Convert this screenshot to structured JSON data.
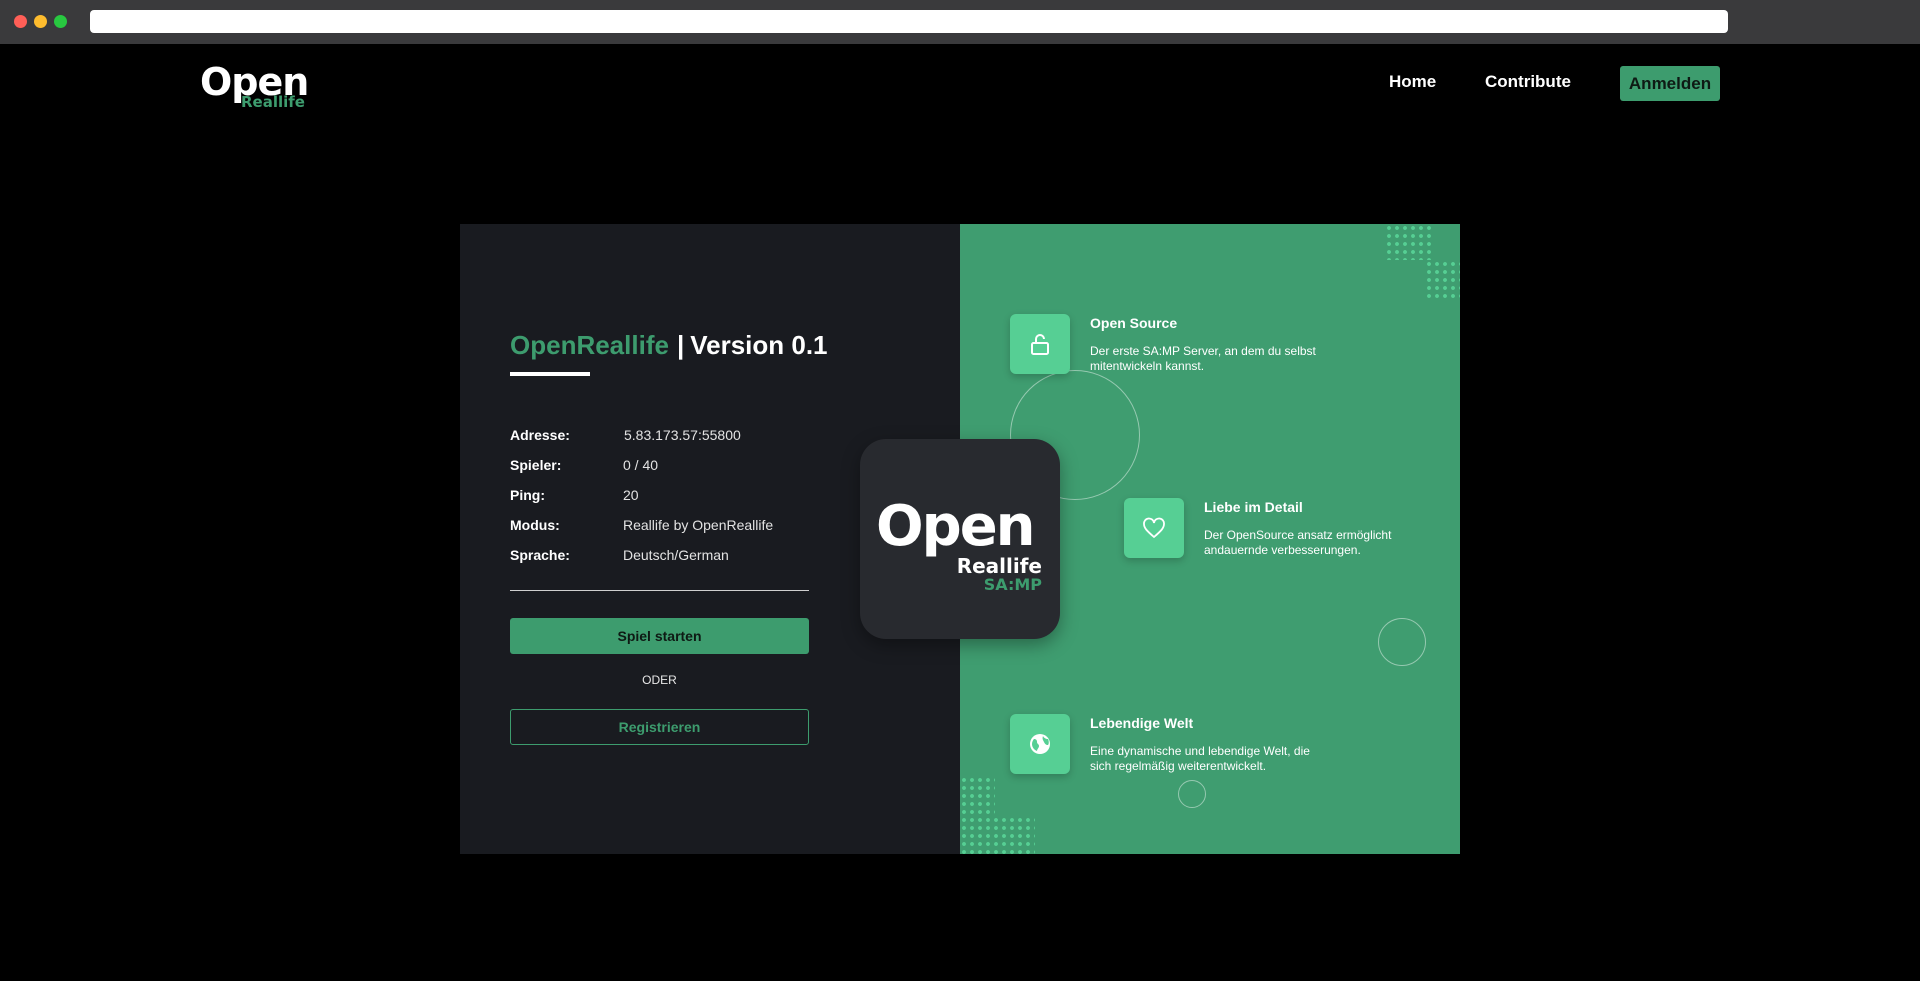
{
  "nav": {
    "logo": {
      "open": "Open",
      "reallife": "Reallife"
    },
    "home": "Home",
    "contribute": "Contribute",
    "login": "Anmelden"
  },
  "server": {
    "title_brand": "OpenReallife",
    "title_separator": "|",
    "title_version": "Version 0.1",
    "rows": [
      {
        "label": "Adresse:",
        "value": "5.83.173.57:55800"
      },
      {
        "label": "Spieler:",
        "value": "0 / 40"
      },
      {
        "label": "Ping:",
        "value": "20"
      },
      {
        "label": "Modus:",
        "value": "Reallife by OpenReallife"
      },
      {
        "label": "Sprache:",
        "value": "Deutsch/German"
      }
    ],
    "play_button": "Spiel starten",
    "or_text": "ODER",
    "register_button": "Registrieren"
  },
  "app_logo": {
    "open": "Open",
    "reallife": "Reallife",
    "samp": "SA:MP"
  },
  "features": [
    {
      "icon": "unlock-icon",
      "title": "Open Source",
      "desc": "Der erste SA:MP Server, an dem du selbst mitentwickeln kannst."
    },
    {
      "icon": "heart-icon",
      "title": "Liebe im Detail",
      "desc": "Der OpenSource ansatz ermöglicht andauernde verbesserungen."
    },
    {
      "icon": "globe-icon",
      "title": "Lebendige Welt",
      "desc": "Eine dynamische und lebendige Welt, die sich regelmäßig weiterentwickelt."
    }
  ],
  "colors": {
    "accent": "#3d9c6e",
    "panel_left": "#191b20",
    "panel_right": "#3f9d70",
    "feature_icon_bg": "#56cf94",
    "background": "#000000"
  }
}
